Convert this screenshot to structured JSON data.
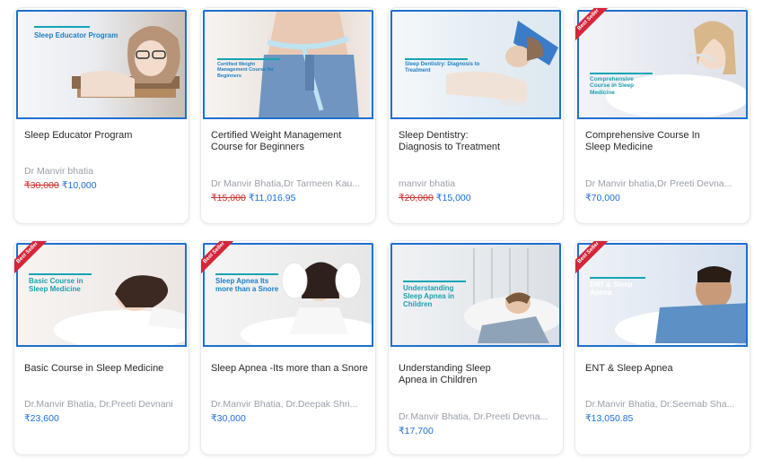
{
  "cards": [
    {
      "thumb_title": "Sleep Educator Program",
      "title": "Sleep Educator Program",
      "author": "Dr Manvir bhatia",
      "old_price": "₹30,000",
      "price": "₹10,000",
      "best_seller": false
    },
    {
      "thumb_title": "Certified Weight Management Course for Beginners",
      "title": "Certified Weight Management Course for Beginners",
      "author": "Dr Manvir Bhatia,Dr Tarmeen Kau...",
      "old_price": "₹15,000",
      "price": "₹11,016.95",
      "best_seller": false
    },
    {
      "thumb_title": "Sleep Dentistry: Diagnosis to Treatment",
      "title": "Sleep Dentistry: Diagnosis to Treatment",
      "author": "manvir bhatia",
      "old_price": "₹20,000",
      "price": "₹15,000",
      "best_seller": false
    },
    {
      "thumb_title": "Comprehensive Course in Sleep Medicine",
      "title": "Comprehensive Course In Sleep Medicine",
      "author": "Dr Manvir bhatia,Dr Preeti Devna...",
      "old_price": "",
      "price": "₹70,000",
      "best_seller": true
    },
    {
      "thumb_title": "Basic Course in Sleep Medicine",
      "title": "Basic Course in Sleep Medicine",
      "author": "Dr.Manvir Bhatia, Dr.Preeti Devnani",
      "old_price": "",
      "price": "₹23,600",
      "best_seller": true
    },
    {
      "thumb_title": "Sleep Apnea Its more than a Snore",
      "title": "Sleep Apnea -Its more than a Snore",
      "author": "Dr.Manvir Bhatia, Dr.Deepak Shri...",
      "old_price": "",
      "price": "₹30,000",
      "best_seller": true
    },
    {
      "thumb_title": "Understanding Sleep Apnea in Children",
      "title": "Understanding Sleep Apnea in Children",
      "author": "Dr.Manvir Bhatia, Dr.Preeti Devna...",
      "old_price": "",
      "price": "₹17,700",
      "best_seller": false
    },
    {
      "thumb_title": "ENT & Sleep Apnea",
      "title": "ENT & Sleep Apnea",
      "author": "Dr.Manvir Bhatia, Dr.Seemab Sha...",
      "old_price": "",
      "price": "₹13,050.85",
      "best_seller": true
    }
  ],
  "ribbon_label": "Best Seller",
  "colors": {
    "accent": "#1e6fd0",
    "price": "#1a6fd6",
    "strike": "#c9302c",
    "ribbon": "#d3263a",
    "line": "#16a4b5"
  }
}
